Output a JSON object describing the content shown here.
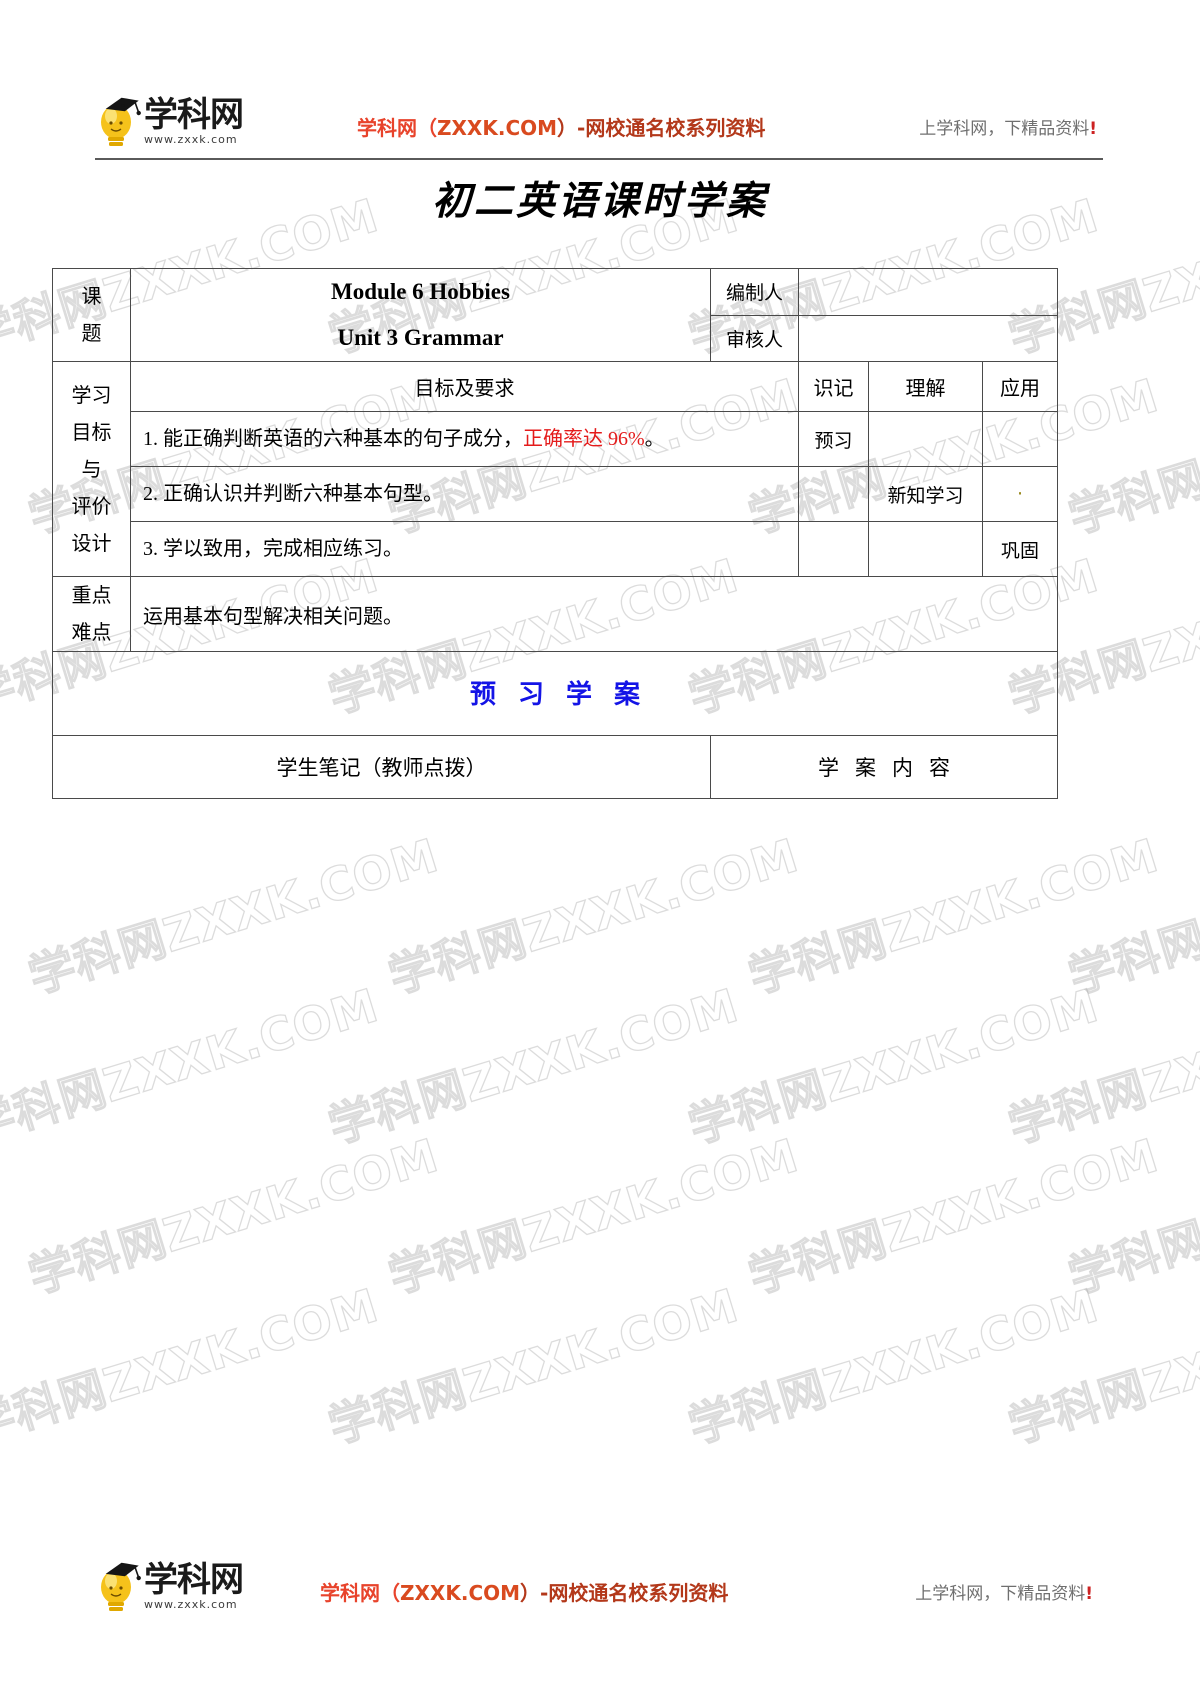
{
  "header": {
    "logo_name": "学科网",
    "logo_url": "www.zxxk.com",
    "slogan_part1": "学科网（",
    "slogan_part2": "ZXXK.COM",
    "slogan_part3": "）-网校通名校系列资料",
    "right_text": "上学科网，下精品资料",
    "right_mark": "!"
  },
  "doc": {
    "title": "初二英语课时学案"
  },
  "table": {
    "topic_label": "课\n题",
    "topic_label_line1": "课",
    "topic_label_line2": "题",
    "topic_line1": "Module 6 Hobbies",
    "topic_line2": "Unit 3 Grammar",
    "author_label": "编制人",
    "author_value": "",
    "reviewer_label": "审核人",
    "reviewer_value": "",
    "objectives_side_label": "学习\n目标\n与\n评价\n设计",
    "objectives_side_l1": "学习",
    "objectives_side_l2": "目标",
    "objectives_side_l3": "与",
    "objectives_side_l4": "评价",
    "objectives_side_l5": "设计",
    "col_goal": "目标及要求",
    "col_recall": "识记",
    "col_understand": "理解",
    "col_apply": "应用",
    "goals": [
      {
        "num": "1.",
        "text_plain": "能正确判断英语的六种基本的句子成分，",
        "text_highlight": "正确率达 96%",
        "text_tail": "。",
        "recall": "预习",
        "understand": "",
        "apply": ""
      },
      {
        "num": "2.",
        "text_plain": "正确认识并判断六种基本句型。",
        "text_highlight": "",
        "text_tail": "",
        "recall": "",
        "understand": "新知学习",
        "apply": "·"
      },
      {
        "num": "3.",
        "text_plain": "学以致用，完成相应练习。",
        "text_highlight": "",
        "text_tail": "",
        "recall": "",
        "understand": "",
        "apply": "巩固"
      }
    ],
    "focus_side_l1": "重点",
    "focus_side_l2": "难点",
    "focus_text": "运用基本句型解决相关问题。",
    "section_banner": "预习学案",
    "notes_header": "学生笔记（教师点拨）",
    "content_header": "学案内容"
  },
  "footer": {
    "logo_name": "学科网",
    "logo_url": "www.zxxk.com",
    "slogan_part1": "学科网（",
    "slogan_part2": "ZXXK.COM",
    "slogan_part3": "）-网校通名校系列资料",
    "right_text": "上学科网，下精品资料",
    "right_mark": "!"
  },
  "watermark": {
    "text": "学科网ZXXK.COM"
  },
  "colors": {
    "brand_red": "#e8432b",
    "highlight_red": "#e41b1b",
    "section_blue": "#1414e6",
    "rule_gray": "#5a5a5a",
    "border": "#4a4a4a"
  }
}
